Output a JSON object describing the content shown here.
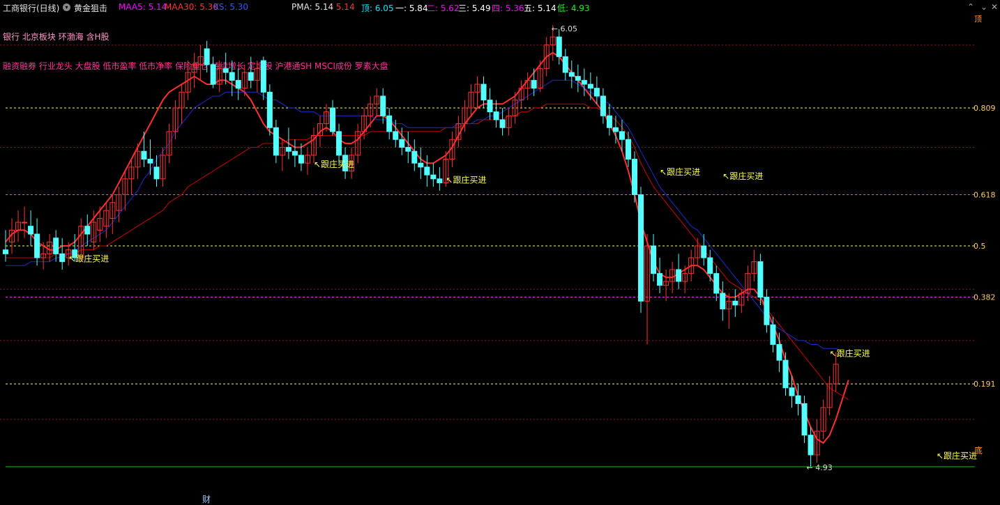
{
  "header": {
    "stock_name": "工商银行(日线)",
    "indicator_name": "黄金狙击",
    "ma5": {
      "label": "MAA5: 5.14",
      "color": "#ff00ff"
    },
    "ma30": {
      "label": "MAA30: 5.30",
      "color": "#ff3333"
    },
    "ks": {
      "label": "KS: 5.30",
      "color": "#3355ff"
    },
    "pma_label": "PMA: 5.14",
    "pma_value": ": 5.14",
    "items": [
      {
        "label": "顶: 6.05",
        "color": "#00e5ff"
      },
      {
        "label": "一: 5.84",
        "color": "#ffffff"
      },
      {
        "label": "二: 5.62",
        "color": "#ff00ff"
      },
      {
        "label": "三: 5.49",
        "color": "#ffffff"
      },
      {
        "label": "四: 5.36",
        "color": "#ff00ff"
      },
      {
        "label": "五: 5.14",
        "color": "#ffffff"
      },
      {
        "label": "低: 4.93",
        "color": "#00ff00"
      }
    ],
    "top_right_marker": "顶"
  },
  "tags": {
    "line1": "银行 北京板块 环渤海 含H股",
    "line2": "融资融券 行业龙头 大盘股 低市盈率 低市净率 保险重仓 持续增长 定增股 沪港通SH MSCI成份 罗素大盘"
  },
  "footer": {
    "cai_label": "财",
    "bottom_marker": "底"
  },
  "chart_data": {
    "type": "candlestick",
    "price_high": 6.05,
    "price_low": 4.93,
    "high_label": "6.05",
    "low_label": "4.93",
    "fib_levels": [
      {
        "label": "0.809",
        "price": 5.84,
        "color": "#ffff66"
      },
      {
        "label": "0.618",
        "price": 5.62,
        "color": "#ff44ff"
      },
      {
        "label": "0.5",
        "price": 5.49,
        "color": "#ffff66"
      },
      {
        "label": "0.382",
        "price": 5.36,
        "color": "#ff44ff"
      },
      {
        "label": "0.191",
        "price": 5.14,
        "color": "#ffff66"
      }
    ],
    "grid_prices": [
      6.0,
      5.74,
      5.38,
      5.25,
      5.05
    ],
    "bottom_line": 4.93,
    "annotations": [
      {
        "text": "↖跟庄买进",
        "index": 10,
        "price": 5.45
      },
      {
        "text": "↖跟庄买进",
        "index": 49,
        "price": 5.69
      },
      {
        "text": "↖跟庄买进",
        "index": 70,
        "price": 5.65
      },
      {
        "text": "↖跟庄买进",
        "index": 104,
        "price": 5.67
      },
      {
        "text": "↖跟庄买进",
        "index": 114,
        "price": 5.66
      },
      {
        "text": "↖跟庄买进",
        "index": 131,
        "price": 5.21
      },
      {
        "text": "↖跟庄买进",
        "index": 148,
        "price": 4.95
      }
    ],
    "candles": [
      [
        5.48,
        5.53,
        5.45,
        5.47
      ],
      [
        5.5,
        5.56,
        5.47,
        5.53
      ],
      [
        5.53,
        5.58,
        5.5,
        5.55
      ],
      [
        5.55,
        5.59,
        5.51,
        5.55
      ],
      [
        5.54,
        5.58,
        5.49,
        5.52
      ],
      [
        5.52,
        5.56,
        5.44,
        5.46
      ],
      [
        5.46,
        5.5,
        5.43,
        5.47
      ],
      [
        5.47,
        5.52,
        5.45,
        5.5
      ],
      [
        5.51,
        5.53,
        5.45,
        5.47
      ],
      [
        5.47,
        5.51,
        5.43,
        5.45
      ],
      [
        5.46,
        5.5,
        5.44,
        5.48
      ],
      [
        5.48,
        5.52,
        5.45,
        5.46
      ],
      [
        5.46,
        5.56,
        5.45,
        5.54
      ],
      [
        5.54,
        5.57,
        5.49,
        5.52
      ],
      [
        5.5,
        5.58,
        5.48,
        5.55
      ],
      [
        5.53,
        5.59,
        5.5,
        5.56
      ],
      [
        5.54,
        5.6,
        5.51,
        5.58
      ],
      [
        5.56,
        5.62,
        5.52,
        5.6
      ],
      [
        5.58,
        5.64,
        5.55,
        5.62
      ],
      [
        5.62,
        5.68,
        5.58,
        5.66
      ],
      [
        5.66,
        5.71,
        5.62,
        5.69
      ],
      [
        5.69,
        5.75,
        5.66,
        5.73
      ],
      [
        5.73,
        5.78,
        5.69,
        5.71
      ],
      [
        5.71,
        5.76,
        5.67,
        5.7
      ],
      [
        5.69,
        5.72,
        5.64,
        5.66
      ],
      [
        5.66,
        5.74,
        5.64,
        5.72
      ],
      [
        5.72,
        5.8,
        5.7,
        5.78
      ],
      [
        5.78,
        5.86,
        5.76,
        5.84
      ],
      [
        5.84,
        5.9,
        5.8,
        5.88
      ],
      [
        5.88,
        5.96,
        5.86,
        5.93
      ],
      [
        5.93,
        5.98,
        5.89,
        5.95
      ],
      [
        5.95,
        6.0,
        5.91,
        5.97
      ],
      [
        5.99,
        6.01,
        5.93,
        5.95
      ],
      [
        5.95,
        5.97,
        5.89,
        5.9
      ],
      [
        5.9,
        5.96,
        5.88,
        5.94
      ],
      [
        5.94,
        5.98,
        5.9,
        5.93
      ],
      [
        5.93,
        5.96,
        5.87,
        5.91
      ],
      [
        5.91,
        5.94,
        5.86,
        5.89
      ],
      [
        5.89,
        5.95,
        5.87,
        5.93
      ],
      [
        5.93,
        5.97,
        5.89,
        5.91
      ],
      [
        5.91,
        5.96,
        5.88,
        5.94
      ],
      [
        5.96,
        5.97,
        5.86,
        5.88
      ],
      [
        5.88,
        5.9,
        5.77,
        5.79
      ],
      [
        5.79,
        5.81,
        5.7,
        5.72
      ],
      [
        5.72,
        5.76,
        5.68,
        5.74
      ],
      [
        5.74,
        5.79,
        5.71,
        5.73
      ],
      [
        5.73,
        5.76,
        5.69,
        5.72
      ],
      [
        5.72,
        5.75,
        5.68,
        5.7
      ],
      [
        5.7,
        5.74,
        5.67,
        5.72
      ],
      [
        5.72,
        5.79,
        5.7,
        5.77
      ],
      [
        5.77,
        5.82,
        5.74,
        5.8
      ],
      [
        5.8,
        5.85,
        5.78,
        5.83
      ],
      [
        5.84,
        5.86,
        5.77,
        5.78
      ],
      [
        5.78,
        5.8,
        5.7,
        5.72
      ],
      [
        5.72,
        5.74,
        5.66,
        5.68
      ],
      [
        5.68,
        5.74,
        5.66,
        5.72
      ],
      [
        5.72,
        5.8,
        5.7,
        5.78
      ],
      [
        5.78,
        5.84,
        5.76,
        5.82
      ],
      [
        5.82,
        5.87,
        5.79,
        5.85
      ],
      [
        5.85,
        5.89,
        5.82,
        5.87
      ],
      [
        5.87,
        5.89,
        5.8,
        5.82
      ],
      [
        5.82,
        5.84,
        5.76,
        5.78
      ],
      [
        5.78,
        5.81,
        5.74,
        5.76
      ],
      [
        5.76,
        5.79,
        5.72,
        5.74
      ],
      [
        5.74,
        5.78,
        5.7,
        5.73
      ],
      [
        5.73,
        5.76,
        5.68,
        5.7
      ],
      [
        5.7,
        5.74,
        5.66,
        5.69
      ],
      [
        5.69,
        5.72,
        5.64,
        5.67
      ],
      [
        5.67,
        5.7,
        5.64,
        5.66
      ],
      [
        5.66,
        5.69,
        5.63,
        5.65
      ],
      [
        5.65,
        5.73,
        5.64,
        5.71
      ],
      [
        5.71,
        5.78,
        5.69,
        5.76
      ],
      [
        5.76,
        5.82,
        5.74,
        5.8
      ],
      [
        5.8,
        5.86,
        5.78,
        5.84
      ],
      [
        5.84,
        5.9,
        5.82,
        5.88
      ],
      [
        5.88,
        5.92,
        5.84,
        5.9
      ],
      [
        5.9,
        5.92,
        5.84,
        5.86
      ],
      [
        5.86,
        5.89,
        5.81,
        5.83
      ],
      [
        5.83,
        5.86,
        5.79,
        5.81
      ],
      [
        5.81,
        5.84,
        5.77,
        5.79
      ],
      [
        5.79,
        5.84,
        5.77,
        5.82
      ],
      [
        5.82,
        5.88,
        5.8,
        5.86
      ],
      [
        5.86,
        5.91,
        5.84,
        5.89
      ],
      [
        5.89,
        5.93,
        5.86,
        5.91
      ],
      [
        5.91,
        5.94,
        5.87,
        5.89
      ],
      [
        5.89,
        5.96,
        5.88,
        5.94
      ],
      [
        5.94,
        6.02,
        5.92,
        6.0
      ],
      [
        6.0,
        6.05,
        5.96,
        6.02
      ],
      [
        6.02,
        6.04,
        5.95,
        5.97
      ],
      [
        5.97,
        5.99,
        5.91,
        5.93
      ],
      [
        5.93,
        5.96,
        5.89,
        5.92
      ],
      [
        5.92,
        5.95,
        5.88,
        5.91
      ],
      [
        5.91,
        5.94,
        5.87,
        5.9
      ],
      [
        5.9,
        5.93,
        5.86,
        5.89
      ],
      [
        5.89,
        5.92,
        5.85,
        5.87
      ],
      [
        5.87,
        5.89,
        5.8,
        5.82
      ],
      [
        5.82,
        5.85,
        5.77,
        5.79
      ],
      [
        5.79,
        5.82,
        5.75,
        5.78
      ],
      [
        5.78,
        5.81,
        5.73,
        5.76
      ],
      [
        5.76,
        5.78,
        5.69,
        5.71
      ],
      [
        5.71,
        5.73,
        5.6,
        5.62
      ],
      [
        5.62,
        5.64,
        5.32,
        5.35
      ],
      [
        5.35,
        5.52,
        5.24,
        5.49
      ],
      [
        5.49,
        5.52,
        5.4,
        5.42
      ],
      [
        5.42,
        5.46,
        5.37,
        5.39
      ],
      [
        5.39,
        5.43,
        5.35,
        5.4
      ],
      [
        5.4,
        5.45,
        5.37,
        5.43
      ],
      [
        5.43,
        5.47,
        5.38,
        5.4
      ],
      [
        5.4,
        5.44,
        5.37,
        5.42
      ],
      [
        5.42,
        5.48,
        5.4,
        5.46
      ],
      [
        5.46,
        5.51,
        5.44,
        5.49
      ],
      [
        5.49,
        5.52,
        5.44,
        5.46
      ],
      [
        5.46,
        5.48,
        5.4,
        5.42
      ],
      [
        5.42,
        5.44,
        5.35,
        5.37
      ],
      [
        5.37,
        5.4,
        5.3,
        5.33
      ],
      [
        5.33,
        5.37,
        5.28,
        5.35
      ],
      [
        5.35,
        5.38,
        5.31,
        5.34
      ],
      [
        5.34,
        5.38,
        5.32,
        5.37
      ],
      [
        5.37,
        5.44,
        5.35,
        5.42
      ],
      [
        5.42,
        5.48,
        5.4,
        5.45
      ],
      [
        5.45,
        5.47,
        5.34,
        5.36
      ],
      [
        5.36,
        5.38,
        5.27,
        5.29
      ],
      [
        5.29,
        5.31,
        5.22,
        5.24
      ],
      [
        5.24,
        5.27,
        5.17,
        5.2
      ],
      [
        5.2,
        5.22,
        5.11,
        5.13
      ],
      [
        5.13,
        5.16,
        5.08,
        5.11
      ],
      [
        5.11,
        5.14,
        5.06,
        5.09
      ],
      [
        5.09,
        5.11,
        4.99,
        5.01
      ],
      [
        5.01,
        5.03,
        4.93,
        4.96
      ],
      [
        4.96,
        5.05,
        4.94,
        5.02
      ],
      [
        5.02,
        5.1,
        5.0,
        5.08
      ],
      [
        5.08,
        5.16,
        5.06,
        5.14
      ],
      [
        5.14,
        5.22,
        5.12,
        5.19
      ]
    ],
    "series": [
      {
        "name": "MAA5",
        "color": "#ff3030",
        "values": [
          5.5,
          5.52,
          5.53,
          5.53,
          5.52,
          5.5,
          5.49,
          5.48,
          5.48,
          5.49,
          5.49,
          5.5,
          5.52,
          5.54,
          5.56,
          5.58,
          5.6,
          5.62,
          5.65,
          5.68,
          5.71,
          5.74,
          5.77,
          5.8,
          5.83,
          5.86,
          5.88,
          5.89,
          5.9,
          5.91,
          5.92,
          5.91,
          5.9,
          5.9,
          5.91,
          5.91,
          5.9,
          5.89,
          5.88,
          5.86,
          5.83,
          5.8,
          5.78,
          5.77,
          5.76,
          5.75,
          5.74,
          5.74,
          5.75,
          5.76,
          5.78,
          5.79,
          5.78,
          5.76,
          5.75,
          5.75,
          5.76,
          5.78,
          5.8,
          5.82,
          5.82,
          5.81,
          5.79,
          5.77,
          5.75,
          5.73,
          5.71,
          5.7,
          5.7,
          5.71,
          5.72,
          5.74,
          5.77,
          5.8,
          5.82,
          5.84,
          5.85,
          5.85,
          5.85,
          5.85,
          5.86,
          5.87,
          5.89,
          5.91,
          5.93,
          5.95,
          5.97,
          5.98,
          5.97,
          5.95,
          5.93,
          5.91,
          5.89,
          5.87,
          5.85,
          5.83,
          5.8,
          5.77,
          5.73,
          5.68,
          5.62,
          5.55,
          5.5,
          5.45,
          5.42,
          5.41,
          5.41,
          5.42,
          5.43,
          5.44,
          5.44,
          5.43,
          5.41,
          5.39,
          5.37,
          5.36,
          5.36,
          5.37,
          5.38,
          5.38,
          5.36,
          5.33,
          5.29,
          5.25,
          5.2,
          5.16,
          5.11,
          5.07,
          5.03,
          5.0,
          4.99,
          5.01,
          5.05,
          5.1,
          5.15
        ]
      },
      {
        "name": "MAA30",
        "color": "#cc0000",
        "values": [
          5.46,
          5.46,
          5.46,
          5.46,
          5.46,
          5.46,
          5.46,
          5.46,
          5.47,
          5.47,
          5.47,
          5.47,
          5.48,
          5.48,
          5.48,
          5.49,
          5.49,
          5.5,
          5.51,
          5.52,
          5.53,
          5.54,
          5.55,
          5.56,
          5.57,
          5.58,
          5.6,
          5.61,
          5.62,
          5.64,
          5.65,
          5.66,
          5.67,
          5.68,
          5.69,
          5.7,
          5.71,
          5.72,
          5.73,
          5.74,
          5.74,
          5.75,
          5.75,
          5.75,
          5.75,
          5.76,
          5.76,
          5.76,
          5.76,
          5.77,
          5.77,
          5.77,
          5.77,
          5.77,
          5.77,
          5.77,
          5.77,
          5.77,
          5.78,
          5.78,
          5.78,
          5.78,
          5.78,
          5.78,
          5.78,
          5.78,
          5.78,
          5.78,
          5.78,
          5.78,
          5.79,
          5.79,
          5.79,
          5.8,
          5.8,
          5.8,
          5.81,
          5.81,
          5.81,
          5.81,
          5.82,
          5.82,
          5.83,
          5.83,
          5.84,
          5.84,
          5.85,
          5.85,
          5.85,
          5.85,
          5.85,
          5.85,
          5.85,
          5.84,
          5.84,
          5.83,
          5.82,
          5.81,
          5.79,
          5.77,
          5.74,
          5.7,
          5.67,
          5.64,
          5.62,
          5.6,
          5.58,
          5.56,
          5.54,
          5.52,
          5.5,
          5.48,
          5.46,
          5.44,
          5.42,
          5.4,
          5.39,
          5.38,
          5.37,
          5.36,
          5.35,
          5.33,
          5.31,
          5.29,
          5.27,
          5.25,
          5.23,
          5.21,
          5.19,
          5.17,
          5.15,
          5.13,
          5.12,
          5.11,
          5.1
        ]
      },
      {
        "name": "KS",
        "color": "#1a2fcc",
        "values": [
          5.44,
          5.44,
          5.44,
          5.44,
          5.45,
          5.45,
          5.45,
          5.45,
          5.46,
          5.46,
          5.47,
          5.48,
          5.49,
          5.5,
          5.51,
          5.52,
          5.53,
          5.55,
          5.57,
          5.59,
          5.61,
          5.63,
          5.66,
          5.68,
          5.71,
          5.73,
          5.75,
          5.78,
          5.8,
          5.82,
          5.84,
          5.85,
          5.86,
          5.87,
          5.87,
          5.88,
          5.88,
          5.88,
          5.88,
          5.88,
          5.88,
          5.87,
          5.86,
          5.86,
          5.85,
          5.84,
          5.84,
          5.83,
          5.83,
          5.83,
          5.82,
          5.82,
          5.82,
          5.82,
          5.82,
          5.82,
          5.82,
          5.82,
          5.82,
          5.81,
          5.81,
          5.81,
          5.8,
          5.8,
          5.79,
          5.79,
          5.79,
          5.79,
          5.79,
          5.79,
          5.79,
          5.79,
          5.8,
          5.8,
          5.8,
          5.81,
          5.81,
          5.82,
          5.82,
          5.83,
          5.84,
          5.85,
          5.86,
          5.87,
          5.88,
          5.89,
          5.9,
          5.91,
          5.91,
          5.91,
          5.91,
          5.9,
          5.89,
          5.88,
          5.87,
          5.86,
          5.85,
          5.83,
          5.81,
          5.79,
          5.76,
          5.73,
          5.7,
          5.67,
          5.64,
          5.62,
          5.6,
          5.58,
          5.56,
          5.54,
          5.53,
          5.51,
          5.49,
          5.47,
          5.45,
          5.43,
          5.41,
          5.39,
          5.37,
          5.35,
          5.33,
          5.31,
          5.29,
          5.28,
          5.27,
          5.26,
          5.25,
          5.25,
          5.24,
          5.24,
          5.23,
          5.23,
          5.23,
          5.22
        ]
      }
    ]
  }
}
